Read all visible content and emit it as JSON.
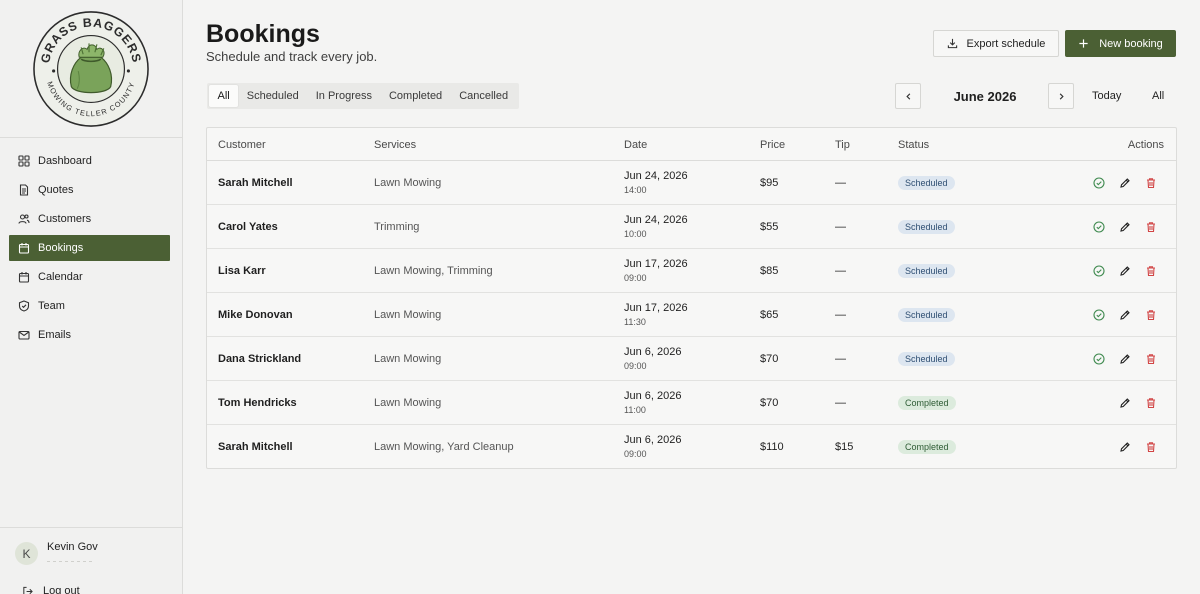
{
  "logo": {
    "top_text": "GRASS BAGGERS",
    "bottom_text": "MOWING TELLER COUNTY",
    "colors": {
      "ring": "#2c2c2c",
      "bag": "#7aa35a",
      "bag_dark": "#5d8542",
      "bg": "#eceee8"
    }
  },
  "sidebar": {
    "items": [
      {
        "label": "Dashboard",
        "icon": "dashboard-icon",
        "active": false
      },
      {
        "label": "Quotes",
        "icon": "document-icon",
        "active": false
      },
      {
        "label": "Customers",
        "icon": "users-icon",
        "active": false
      },
      {
        "label": "Bookings",
        "icon": "calendar-icon",
        "active": true
      },
      {
        "label": "Calendar",
        "icon": "calendar-icon",
        "active": false
      },
      {
        "label": "Team",
        "icon": "shield-icon",
        "active": false
      },
      {
        "label": "Emails",
        "icon": "mail-icon",
        "active": false
      }
    ],
    "user": {
      "initial": "K",
      "name": "Kevin Gov"
    },
    "logout_label": "Log out"
  },
  "header": {
    "title": "Bookings",
    "subtitle": "Schedule and track every job.",
    "export_label": "Export schedule",
    "new_label": "New booking"
  },
  "filters": {
    "tabs": [
      "All",
      "Scheduled",
      "In Progress",
      "Completed",
      "Cancelled"
    ],
    "active_tab": "All"
  },
  "date_nav": {
    "month": "June 2026",
    "today_label": "Today",
    "all_label": "All"
  },
  "table": {
    "columns": [
      "Customer",
      "Services",
      "Date",
      "Price",
      "Tip",
      "Status",
      "Actions"
    ],
    "rows": [
      {
        "customer": "Sarah Mitchell",
        "services": "Lawn Mowing",
        "date": "Jun 24, 2026",
        "time": "14:00",
        "price": "$95",
        "tip": "—",
        "status": "Scheduled"
      },
      {
        "customer": "Carol Yates",
        "services": "Trimming",
        "date": "Jun 24, 2026",
        "time": "10:00",
        "price": "$55",
        "tip": "—",
        "status": "Scheduled"
      },
      {
        "customer": "Lisa Karr",
        "services": "Lawn Mowing, Trimming",
        "date": "Jun 17, 2026",
        "time": "09:00",
        "price": "$85",
        "tip": "—",
        "status": "Scheduled"
      },
      {
        "customer": "Mike Donovan",
        "services": "Lawn Mowing",
        "date": "Jun 17, 2026",
        "time": "11:30",
        "price": "$65",
        "tip": "—",
        "status": "Scheduled"
      },
      {
        "customer": "Dana Strickland",
        "services": "Lawn Mowing",
        "date": "Jun 6, 2026",
        "time": "09:00",
        "price": "$70",
        "tip": "—",
        "status": "Scheduled"
      },
      {
        "customer": "Tom Hendricks",
        "services": "Lawn Mowing",
        "date": "Jun 6, 2026",
        "time": "11:00",
        "price": "$70",
        "tip": "—",
        "status": "Completed"
      },
      {
        "customer": "Sarah Mitchell",
        "services": "Lawn Mowing, Yard Cleanup",
        "date": "Jun 6, 2026",
        "time": "09:00",
        "price": "$110",
        "tip": "$15",
        "status": "Completed"
      }
    ]
  },
  "colors": {
    "accent": "#4b6034",
    "check": "#3f8a4f",
    "delete": "#d24545",
    "scheduled_bg": "#dde6f0",
    "completed_bg": "#dcebdd"
  }
}
